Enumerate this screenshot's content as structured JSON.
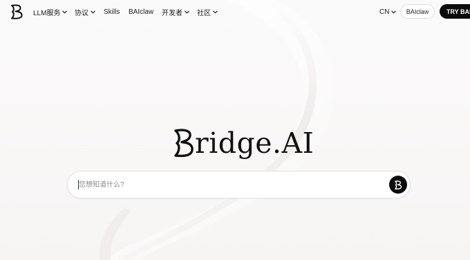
{
  "brand": {
    "logo_icon": "bridge-b-logo-icon",
    "hero_text": "ridge.AI"
  },
  "nav": {
    "items": [
      {
        "label": "LLM服务",
        "has_dropdown": true
      },
      {
        "label": "协议",
        "has_dropdown": true
      },
      {
        "label": "Skills",
        "has_dropdown": false
      },
      {
        "label": "BAIclaw",
        "has_dropdown": false
      },
      {
        "label": "开发者",
        "has_dropdown": true
      },
      {
        "label": "社区",
        "has_dropdown": true
      }
    ],
    "language": "CN",
    "baiclaw_button": "BAIclaw",
    "try_button": "TRY BAI"
  },
  "search": {
    "placeholder": "您想知道什么?",
    "value": "",
    "send_icon": "bridge-b-send-icon"
  },
  "colors": {
    "primary": "#0b0b0b",
    "background": "#f9f8f7",
    "border": "#e2e0df"
  }
}
